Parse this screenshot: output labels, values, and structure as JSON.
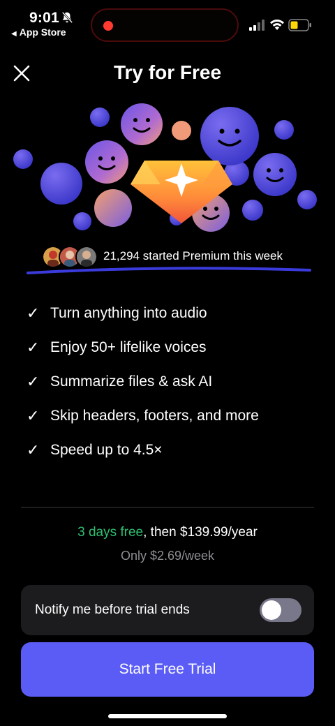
{
  "status_bar": {
    "time": "9:01",
    "back_app": "App Store",
    "icons": [
      "bell-slash-icon",
      "signal-icon",
      "wifi-icon",
      "battery-icon"
    ]
  },
  "header": {
    "title": "Try for Free",
    "close_icon": "close-icon"
  },
  "social_proof": {
    "text": "21,294 started Premium this week"
  },
  "features": [
    {
      "check": "✓",
      "label": "Turn anything into audio"
    },
    {
      "check": "✓",
      "label": "Enjoy 50+ lifelike voices"
    },
    {
      "check": "✓",
      "label": "Summarize files & ask AI"
    },
    {
      "check": "✓",
      "label": "Skip headers, footers, and more"
    },
    {
      "check": "✓",
      "label": "Speed up to 4.5×"
    }
  ],
  "pricing": {
    "free_text": "3 days free",
    "then_text": ", then $139.99/year",
    "weekly_text": "Only $2.69/week"
  },
  "notify": {
    "label": "Notify me before trial ends",
    "toggle_on": false
  },
  "cta": {
    "label": "Start Free Trial"
  },
  "colors": {
    "accent": "#5b5cf6",
    "free_green": "#2fbf71",
    "battery_yellow": "#ffd60a",
    "underline_blue": "#3b3bdd"
  }
}
